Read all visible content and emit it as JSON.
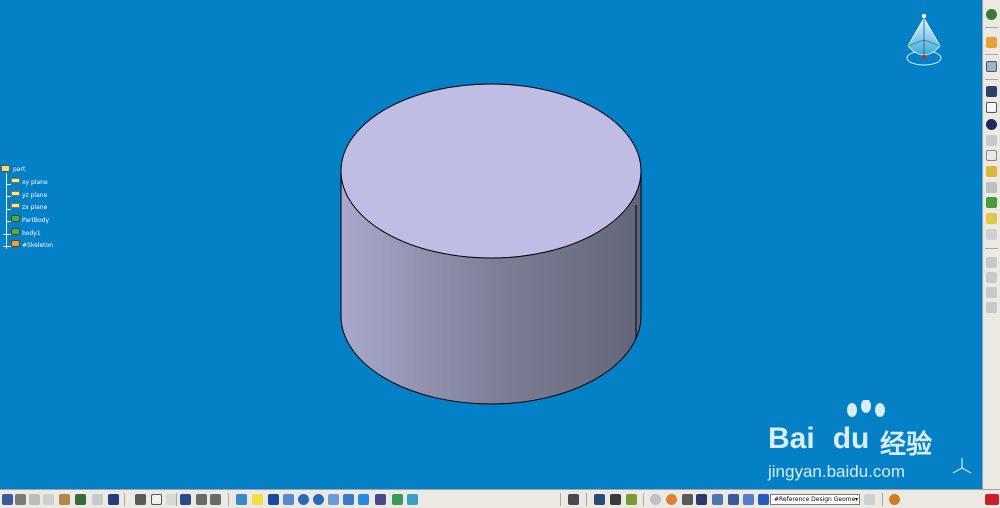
{
  "tree": {
    "root": {
      "label": "part",
      "icon": "part-icon"
    },
    "items": [
      {
        "label": "xy plane",
        "icon": "plane-icon"
      },
      {
        "label": "yz plane",
        "icon": "plane-icon"
      },
      {
        "label": "zx plane",
        "icon": "plane-icon"
      },
      {
        "label": "PartBody",
        "icon": "body-icon"
      },
      {
        "label": "body1",
        "icon": "body-icon"
      },
      {
        "label": "#Skeleton",
        "icon": "skeleton-icon"
      }
    ]
  },
  "toolbar": {
    "geometry_select_value": "#Reference Design Geome"
  },
  "watermark": {
    "brand": "Bai",
    "brand2": "du",
    "cn": "经验",
    "url": "jingyan.baidu.com"
  },
  "colors": {
    "viewport_bg": "#0480c6",
    "cylinder_top": "#c0bde5",
    "cylinder_side_light": "#a6a5c9",
    "cylinder_side_dark": "#666a80"
  }
}
